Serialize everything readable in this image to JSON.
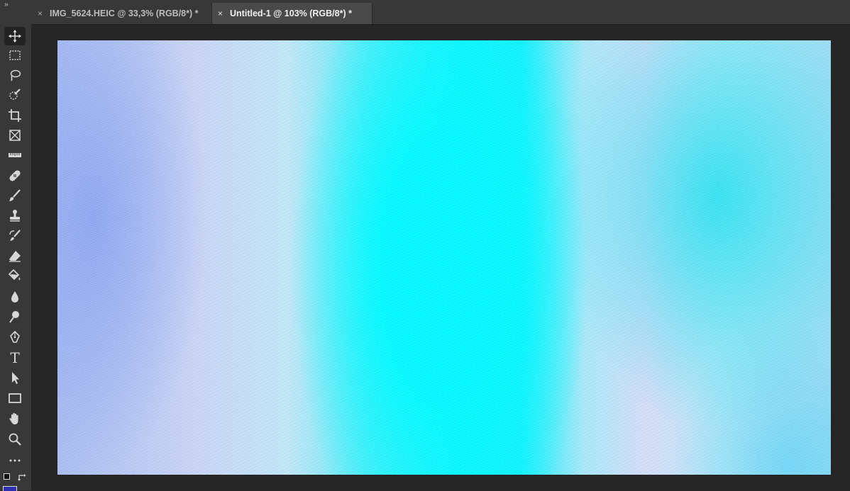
{
  "tabs": [
    {
      "label": "IMG_5624.HEIC @ 33,3% (RGB/8*) *",
      "close": "×",
      "active": false
    },
    {
      "label": "Untitled-1 @ 103% (RGB/8*) *",
      "close": "×",
      "active": true
    }
  ],
  "panel_toggle": "››",
  "tools": [
    "move-tool-icon",
    "rectangular-marquee-icon",
    "lasso-icon",
    "quick-selection-icon",
    "crop-icon",
    "frame-icon",
    "ruler-icon",
    "healing-brush-icon",
    "brush-icon",
    "clone-stamp-icon",
    "history-brush-icon",
    "eraser-icon",
    "paint-bucket-icon",
    "blur-icon",
    "dodge-icon",
    "pen-icon",
    "type-icon",
    "path-selection-icon",
    "rectangle-icon",
    "hand-icon",
    "zoom-icon",
    "more-tools-icon"
  ],
  "type_tool_glyph": "T",
  "colors": {
    "app_bg": "#262626",
    "panel": "#383838",
    "cyan": "#00f5ff",
    "periwinkle": "#aebef0"
  }
}
